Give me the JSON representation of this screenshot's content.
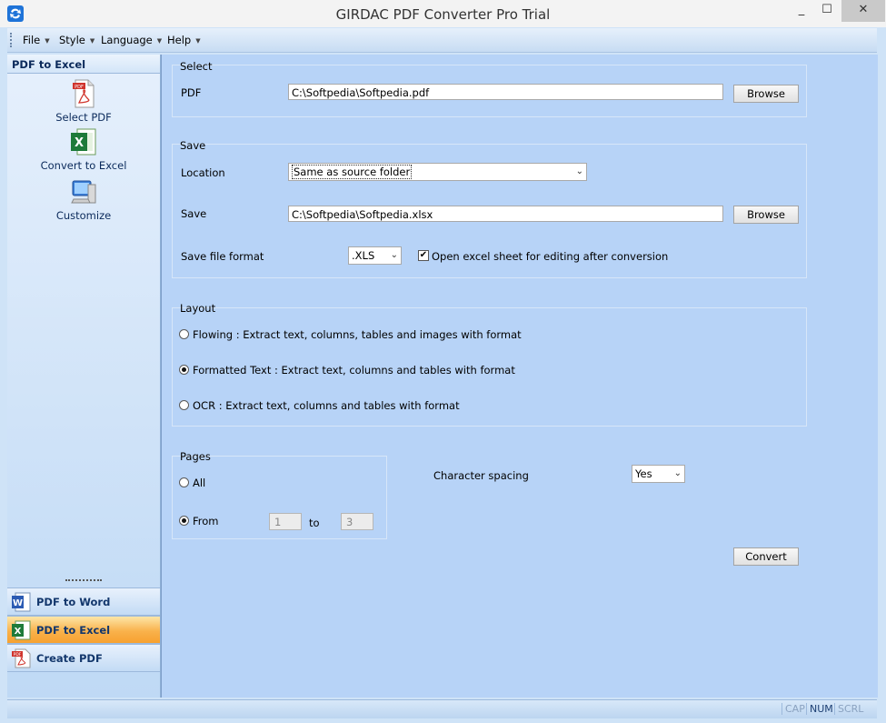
{
  "window": {
    "title": "GIRDAC PDF Converter Pro Trial",
    "minimize": "_",
    "maximize": "☐",
    "close": "✕"
  },
  "menu": [
    {
      "label": "File"
    },
    {
      "label": "Style"
    },
    {
      "label": "Language"
    },
    {
      "label": "Help"
    }
  ],
  "sidebar": {
    "title": "PDF to Excel",
    "tools": [
      {
        "label": "Select PDF",
        "icon": "pdf-document-icon"
      },
      {
        "label": "Convert to Excel",
        "icon": "excel-icon"
      },
      {
        "label": "Customize",
        "icon": "computer-icon"
      }
    ],
    "nav": [
      {
        "label": "PDF to Word",
        "icon": "word-icon",
        "active": false
      },
      {
        "label": "PDF to Excel",
        "icon": "excel-icon",
        "active": true
      },
      {
        "label": "Create PDF",
        "icon": "pdf-icon",
        "active": false
      }
    ]
  },
  "select_group": {
    "title": "Select",
    "pdf_label": "PDF",
    "pdf_path": "C:\\Softpedia\\Softpedia.pdf",
    "browse": "Browse"
  },
  "save_group": {
    "title": "Save",
    "location_label": "Location",
    "location_value": "Same as source folder",
    "save_label": "Save",
    "save_path": "C:\\Softpedia\\Softpedia.xlsx",
    "browse": "Browse",
    "format_label": "Save file format",
    "format_value": ".XLS",
    "open_checkbox_label": "Open excel sheet for editing after conversion",
    "open_checked": true
  },
  "layout_group": {
    "title": "Layout",
    "options": [
      {
        "label": "Flowing :  Extract text, columns, tables and images with format",
        "selected": false
      },
      {
        "label": "Formatted Text :  Extract text, columns and tables with format",
        "selected": true
      },
      {
        "label": "OCR :  Extract text, columns and tables with format",
        "selected": false
      }
    ]
  },
  "pages_group": {
    "title": "Pages",
    "all_label": "All",
    "from_label": "From",
    "from_value": "1",
    "to_label": "to",
    "to_value": "3",
    "selected": "From"
  },
  "char_spacing": {
    "label": "Character spacing",
    "value": "Yes"
  },
  "convert": "Convert",
  "status": [
    "CAP",
    "NUM",
    "SCRL"
  ],
  "colors": {
    "accent_active": "#f9b24c",
    "panel": "#b7d3f7"
  }
}
